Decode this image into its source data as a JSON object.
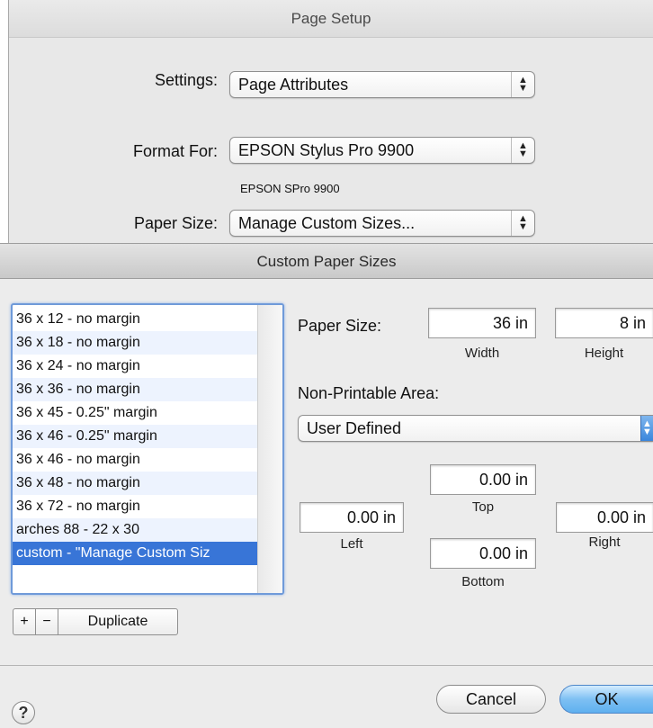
{
  "page_setup": {
    "title": "Page Setup",
    "settings_label": "Settings:",
    "settings_value": "Page Attributes",
    "format_label": "Format For:",
    "format_value": "EPSON Stylus Pro 9900",
    "format_subtitle": "EPSON SPro 9900",
    "paper_size_label": "Paper Size:",
    "paper_size_value": "Manage Custom Sizes..."
  },
  "custom_sizes": {
    "title": "Custom Paper Sizes",
    "items": [
      "36 x 12 - no margin",
      "36 x 18 - no margin",
      "36 x 24 - no margin",
      "36 x 36 - no margin",
      "36 x 45 - 0.25\" margin",
      "36 x 46 - 0.25\" margin",
      "36 x 46 - no margin",
      "36 x 48 - no margin",
      "36 x 72 - no margin",
      "arches 88 - 22 x 30",
      "custom - \"Manage Custom Siz"
    ],
    "selected_index": 10,
    "add_label": "+",
    "remove_label": "−",
    "duplicate_label": "Duplicate",
    "paper_size_label": "Paper Size:",
    "width_value": "36 in",
    "width_caption": "Width",
    "height_value": "8 in",
    "height_caption": "Height",
    "non_printable_label": "Non-Printable Area:",
    "non_printable_value": "User Defined",
    "top_value": "0.00 in",
    "top_caption": "Top",
    "left_value": "0.00 in",
    "left_caption": "Left",
    "right_value": "0.00 in",
    "right_caption": "Right",
    "bottom_value": "0.00 in",
    "bottom_caption": "Bottom",
    "help_label": "?",
    "cancel_label": "Cancel",
    "ok_label": "OK"
  }
}
